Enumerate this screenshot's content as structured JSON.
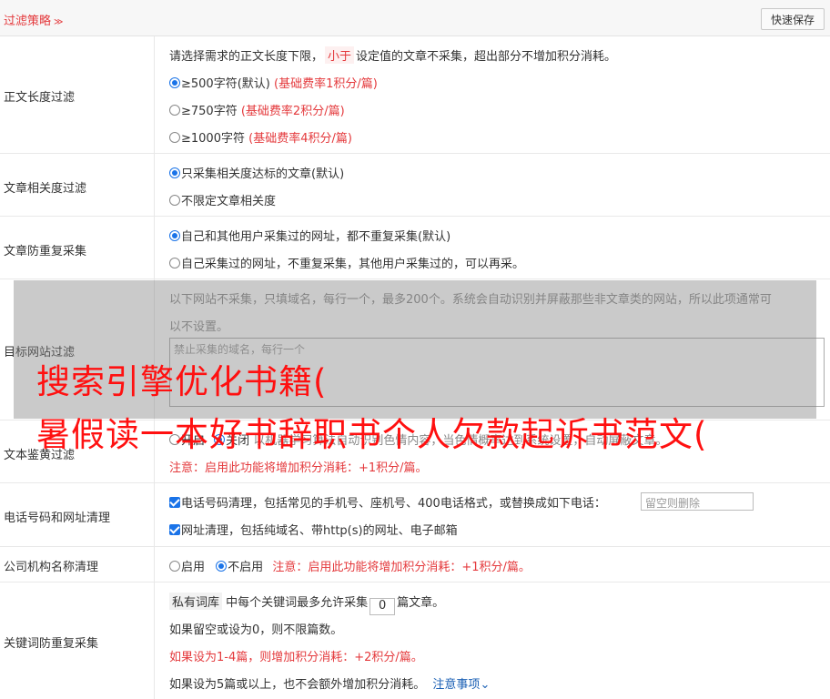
{
  "header": {
    "title": "过滤策略",
    "chevron": "≫",
    "save_label": "快速保存"
  },
  "length": {
    "label": "正文长度过滤",
    "desc_pre": "请选择需求的正文长度下限，",
    "desc_tag": "小于",
    "desc_post": "设定值的文章不采集，超出部分不增加积分消耗。",
    "options": [
      {
        "text": "≥500字符(默认)",
        "note": "(基础费率1积分/篇)"
      },
      {
        "text": "≥750字符",
        "note": "(基础费率2积分/篇)"
      },
      {
        "text": "≥1000字符",
        "note": "(基础费率4积分/篇)"
      }
    ]
  },
  "relevance": {
    "label": "文章相关度过滤",
    "opt1": "只采集相关度达标的文章(默认)",
    "opt2": "不限定文章相关度"
  },
  "dedup": {
    "label": "文章防重复采集",
    "opt1": "自己和其他用户采集过的网址，都不重复采集(默认)",
    "opt2": "自己采集过的网址，不重复采集，其他用户采集过的，可以再采。"
  },
  "site": {
    "label": "目标网站过滤",
    "desc1": "以下网站不采集，只填域名，每行一个，最多200个。系统会自动识别并屏蔽那些非文章类的网站，所以此项通常可",
    "desc2": "以不设置。",
    "placeholder": "禁止采集的域名，每行一个"
  },
  "porn": {
    "label": "文本鉴黄过滤",
    "on": "开启",
    "off": "关闭",
    "desc": "以机器学习算法自动识别色情内容，当色情概率达到系统设置，自动屏蔽文章。",
    "note": "注意：启用此功能将增加积分消耗：+1积分/篇。"
  },
  "phone": {
    "label": "电话号码和网址清理",
    "opt1": "电话号码清理，包括常见的手机号、座机号、400电话格式，或替换成如下电话：",
    "placeholder": "留空则删除",
    "opt2": "网址清理，包括纯域名、带http(s)的网址、电子邮箱"
  },
  "org": {
    "label": "公司机构名称清理",
    "on": "启用",
    "off": "不启用",
    "note": "注意：启用此功能将增加积分消耗：+1积分/篇。"
  },
  "keyword": {
    "label": "关键词防重复采集",
    "tag": "私有词库",
    "line1_a": "中每个关键词最多允许采集",
    "count": "0",
    "line1_b": "篇文章。",
    "line2": "如果留空或设为0，则不限篇数。",
    "line3": "如果设为1-4篇，则增加积分消耗：+2积分/篇。",
    "line4": "如果设为5篇或以上，也不会额外增加积分消耗。",
    "link": "注意事项",
    "link_chevron": "⌄"
  },
  "watermark": {
    "line1": "搜索引擎优化书籍(",
    "line2": "暑假读一本好书辞职书个人欠款起诉书范文("
  }
}
